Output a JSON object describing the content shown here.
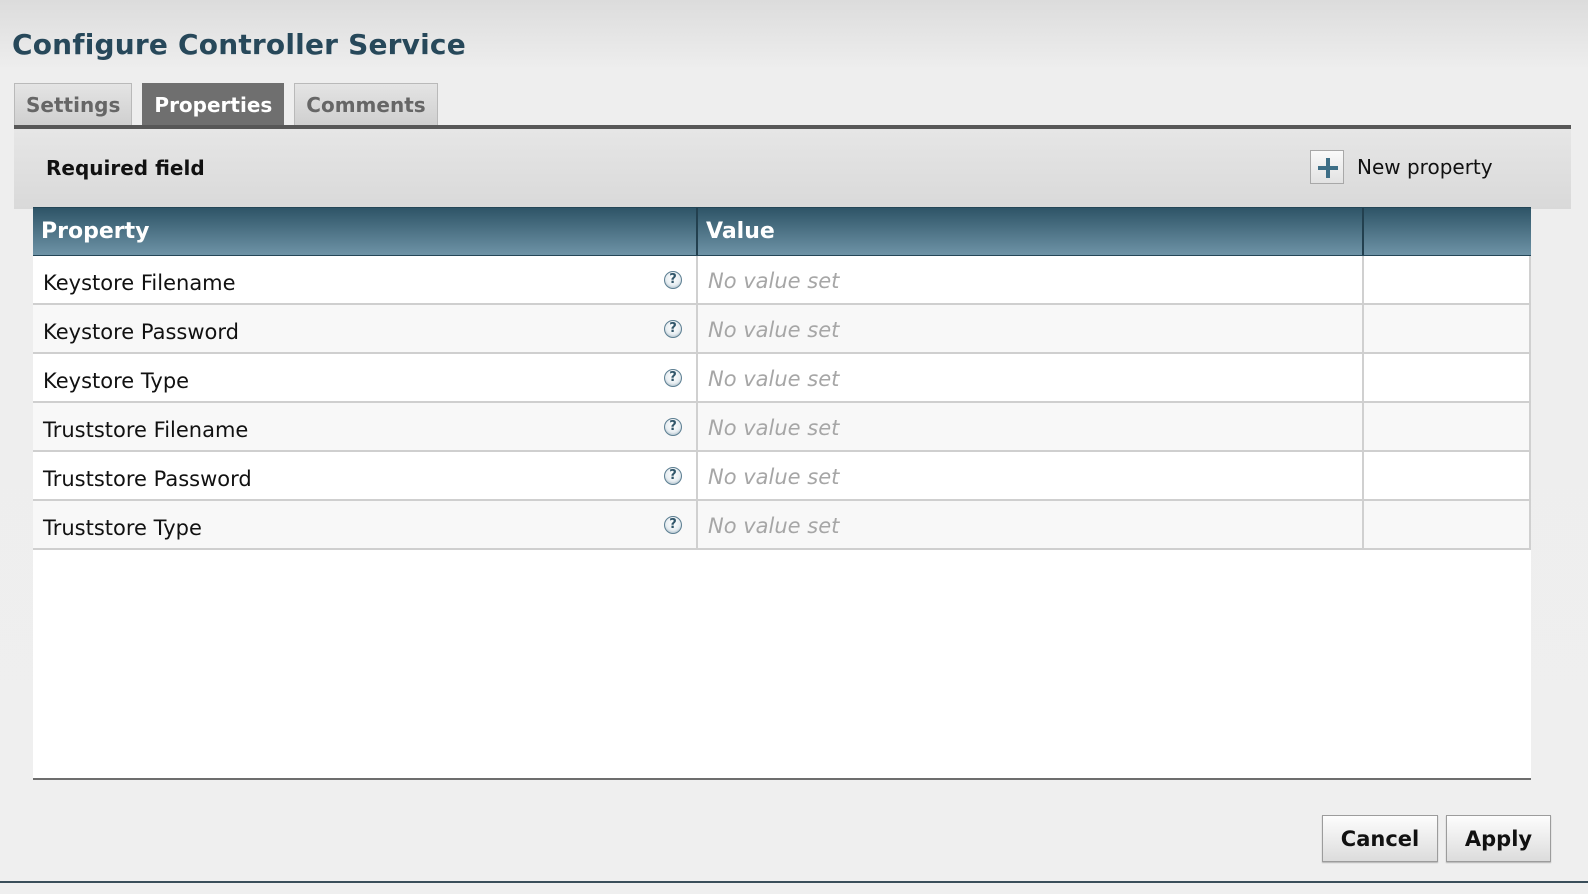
{
  "dialog": {
    "title": "Configure Controller Service"
  },
  "tabs": [
    {
      "label": "Settings",
      "active": false
    },
    {
      "label": "Properties",
      "active": true
    },
    {
      "label": "Comments",
      "active": false
    }
  ],
  "properties_panel": {
    "required_label": "Required field",
    "new_property_label": "New property",
    "new_property_icon": "plus-icon"
  },
  "grid": {
    "columns": [
      "Property",
      "Value",
      ""
    ],
    "rows": [
      {
        "property": "Keystore Filename",
        "value": "No value set"
      },
      {
        "property": "Keystore Password",
        "value": "No value set"
      },
      {
        "property": "Keystore Type",
        "value": "No value set"
      },
      {
        "property": "Truststore Filename",
        "value": "No value set"
      },
      {
        "property": "Truststore Password",
        "value": "No value set"
      },
      {
        "property": "Truststore Type",
        "value": "No value set"
      }
    ],
    "help_icon": "question-icon"
  },
  "buttons": {
    "cancel": "Cancel",
    "apply": "Apply"
  },
  "colors": {
    "title": "#27485a",
    "header_dark": "#2e5467",
    "header_light": "#6e93a6",
    "active_tab": "#6f6f6f"
  }
}
